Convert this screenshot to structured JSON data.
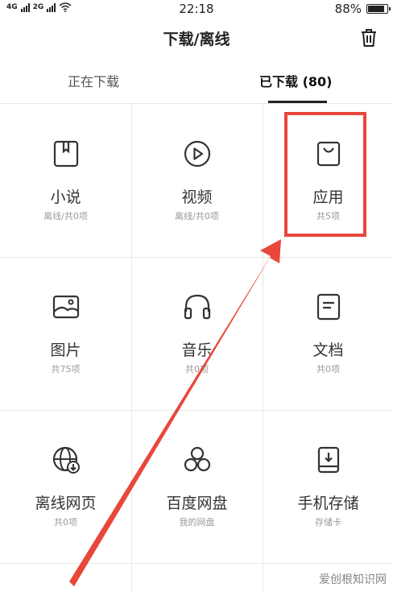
{
  "status_bar": {
    "network_1": "4G",
    "network_2": "2G",
    "time": "22:18",
    "battery": "88%",
    "battery_level": 0.88
  },
  "header": {
    "title": "下载/离线",
    "trash_icon": "trash-icon"
  },
  "tabs": [
    {
      "label": "正在下载",
      "active": false
    },
    {
      "label": "已下载 (80)",
      "active": true
    }
  ],
  "grid": [
    {
      "label": "小说",
      "sub": "离线/共0项",
      "icon": "book-icon"
    },
    {
      "label": "视频",
      "sub": "离线/共0项",
      "icon": "play-icon"
    },
    {
      "label": "应用",
      "sub": "共5项",
      "icon": "shopping-bag-icon"
    },
    {
      "label": "图片",
      "sub": "共75项",
      "icon": "image-icon"
    },
    {
      "label": "音乐",
      "sub": "共0项",
      "icon": "headphones-icon"
    },
    {
      "label": "文档",
      "sub": "共0项",
      "icon": "document-icon"
    },
    {
      "label": "离线网页",
      "sub": "共0项",
      "icon": "globe-download-icon"
    },
    {
      "label": "百度网盘",
      "sub": "我的网盘",
      "icon": "cloud-circles-icon"
    },
    {
      "label": "手机存储",
      "sub": "存储卡",
      "icon": "storage-icon"
    }
  ],
  "annotation": {
    "highlight_color": "#e8473a"
  },
  "watermark": "爱创根知识网"
}
